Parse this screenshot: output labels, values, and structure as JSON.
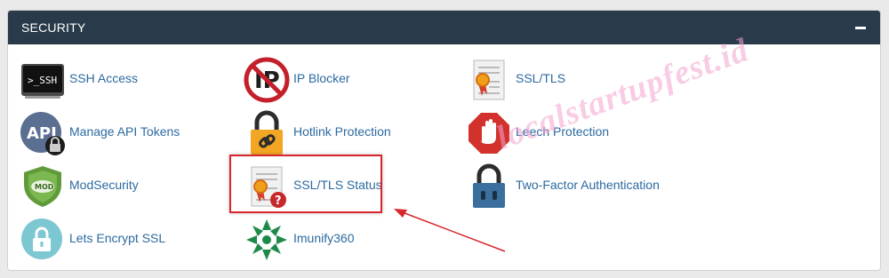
{
  "section": {
    "title": "SECURITY",
    "collapse_icon": "minus-icon"
  },
  "items": [
    {
      "label": "SSH Access",
      "icon": "ssh-terminal-icon"
    },
    {
      "label": "IP Blocker",
      "icon": "ip-blocker-icon"
    },
    {
      "label": "SSL/TLS",
      "icon": "certificate-icon"
    },
    {
      "label": "Manage API Tokens",
      "icon": "api-lock-icon"
    },
    {
      "label": "Hotlink Protection",
      "icon": "chain-lock-icon"
    },
    {
      "label": "Leech Protection",
      "icon": "stop-hand-icon"
    },
    {
      "label": "ModSecurity",
      "icon": "mod-shield-icon"
    },
    {
      "label": "SSL/TLS Status",
      "icon": "certificate-question-icon"
    },
    {
      "label": "Two-Factor Authentication",
      "icon": "padlock-icon"
    },
    {
      "label": "Lets Encrypt SSL",
      "icon": "lock-circle-icon"
    },
    {
      "label": "Imunify360",
      "icon": "imunify-icon"
    }
  ],
  "watermark": "localstartupfest.id",
  "colors": {
    "header_bg": "#293a4a",
    "link": "#2c6aa0",
    "highlight": "#d9252b",
    "watermark": "#f4a3cf"
  }
}
